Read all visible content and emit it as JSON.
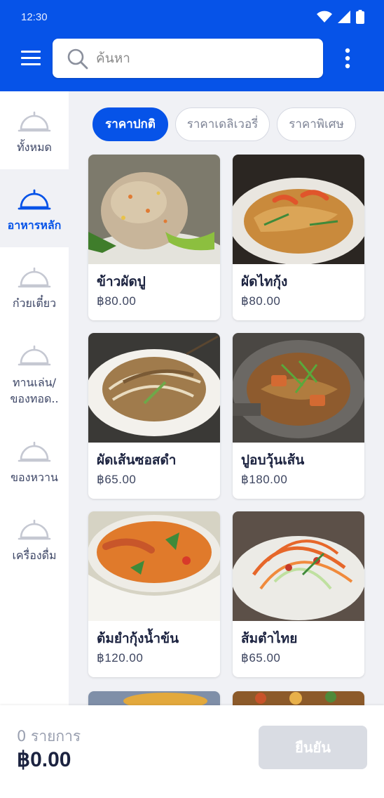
{
  "status_bar": {
    "time": "12:30"
  },
  "search": {
    "placeholder": "ค้นหา"
  },
  "sidebar": {
    "items": [
      {
        "label": "ทั้งหมด",
        "icon": "cloche-icon",
        "active": false
      },
      {
        "label": "อาหารหลัก",
        "icon": "cloche-icon",
        "active": true
      },
      {
        "label": "ก๋วยเตี๋ยว",
        "icon": "cloche-icon",
        "active": false
      },
      {
        "label_line1": "ทานเล่น/",
        "label_line2": "ของทอด..",
        "icon": "cloche-icon",
        "active": false
      },
      {
        "label": "ของหวาน",
        "icon": "cloche-icon",
        "active": false
      },
      {
        "label": "เครื่องดื่ม",
        "icon": "cloche-icon",
        "active": false
      }
    ]
  },
  "price_tabs": [
    {
      "label": "ราคาปกติ",
      "active": true
    },
    {
      "label": "ราคาเดลิเวอรี่",
      "active": false
    },
    {
      "label": "ราคาพิเศษ",
      "active": false
    }
  ],
  "menu_items": [
    {
      "name": "ข้าวผัดปู",
      "price": "฿80.00"
    },
    {
      "name": "ผัดไทกุ้ง",
      "price": "฿80.00"
    },
    {
      "name": "ผัดเส้นซอสดำ",
      "price": "฿65.00"
    },
    {
      "name": "ปูอบวุ้นเส้น",
      "price": "฿180.00"
    },
    {
      "name": "ต้มยำกุ้งน้ำข้น",
      "price": "฿120.00"
    },
    {
      "name": "ส้มตำไทย",
      "price": "฿65.00"
    }
  ],
  "cart": {
    "count_label": "0 รายการ",
    "total": "฿0.00",
    "confirm_label": "ยืนยัน"
  },
  "colors": {
    "primary": "#0653e8",
    "background": "#f0f1f5",
    "disabled_button": "#d9dce3"
  }
}
